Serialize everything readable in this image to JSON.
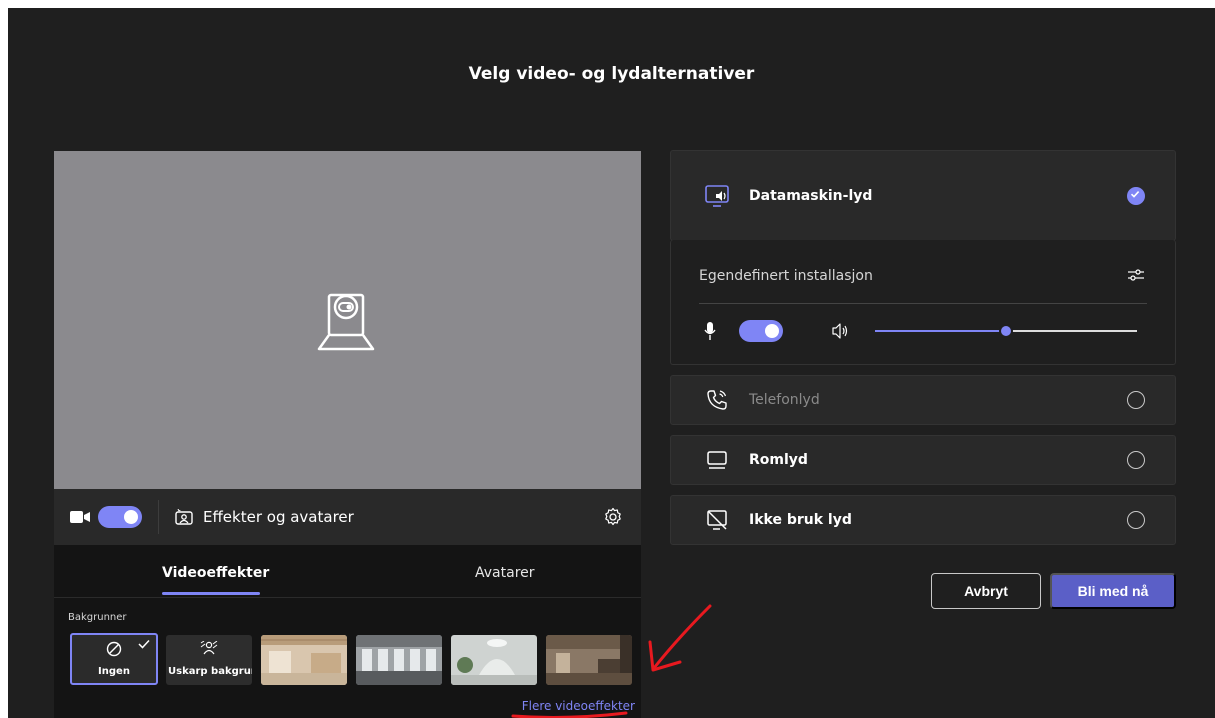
{
  "dialog": {
    "title": "Velg video- og lydalternativer"
  },
  "video": {
    "camera_on": true,
    "effects_button_label": "Effekter og avatarer"
  },
  "effects_panel": {
    "tabs": [
      {
        "label": "Videoeffekter",
        "active": true
      },
      {
        "label": "Avatarer",
        "active": false
      }
    ],
    "backgrounds_label": "Bakgrunner",
    "backgrounds": [
      {
        "label": "Ingen",
        "selected": true
      },
      {
        "label": "Uskarp bakgrunn",
        "selected": false
      }
    ],
    "more_effects_link": "Flere videoeffekter"
  },
  "audio": {
    "computer_audio": {
      "label": "Datamaskin-lyd",
      "selected": true
    },
    "custom_setup_label": "Egendefinert installasjon",
    "mic_on": true,
    "speaker_volume_percent": 50,
    "options": [
      {
        "label": "Telefonlyd",
        "disabled": true
      },
      {
        "label": "Romlyd",
        "disabled": false
      },
      {
        "label": "Ikke bruk lyd",
        "disabled": false
      }
    ]
  },
  "actions": {
    "cancel_label": "Avbryt",
    "join_label": "Bli med nå"
  },
  "colors": {
    "accent": "#7f85f5",
    "join": "#5b5fc7",
    "annotation": "#e8191f"
  }
}
